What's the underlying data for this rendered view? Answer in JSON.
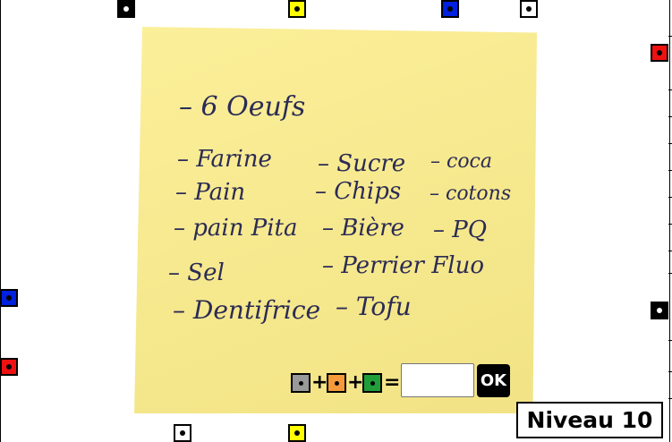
{
  "note": {
    "lines": [
      "– 6 Oeufs",
      "– Farine",
      "– Sucre",
      "– coca",
      "– Pain",
      "– Chips",
      "– cotons",
      "– pain Pita",
      "– Bière",
      "– PQ",
      "– Sel",
      "– Perrier Fluo",
      "– Dentifrice",
      "– Tofu"
    ]
  },
  "equation": {
    "pegs": [
      {
        "color": "#999999",
        "dot": "#000000"
      },
      {
        "color": "#f59a3a",
        "dot": "#000000"
      },
      {
        "color": "#1f9e3a",
        "dot": "#000000"
      }
    ],
    "plus": "+",
    "equals": "=",
    "answer_value": "",
    "ok_label": "OK"
  },
  "level": {
    "label": "Niveau 10"
  },
  "pegs": {
    "top": [
      "black",
      "yellow",
      "blue",
      "white"
    ],
    "left": [
      "blue",
      "red"
    ],
    "right": [
      "red",
      "black"
    ],
    "bottom": [
      "white",
      "yellow"
    ]
  },
  "colors": {
    "yellow": "#ffff00",
    "blue": "#0020e0",
    "red": "#ee1111",
    "black": "#000000",
    "white": "#ffffff",
    "note": "#f6e88d"
  }
}
